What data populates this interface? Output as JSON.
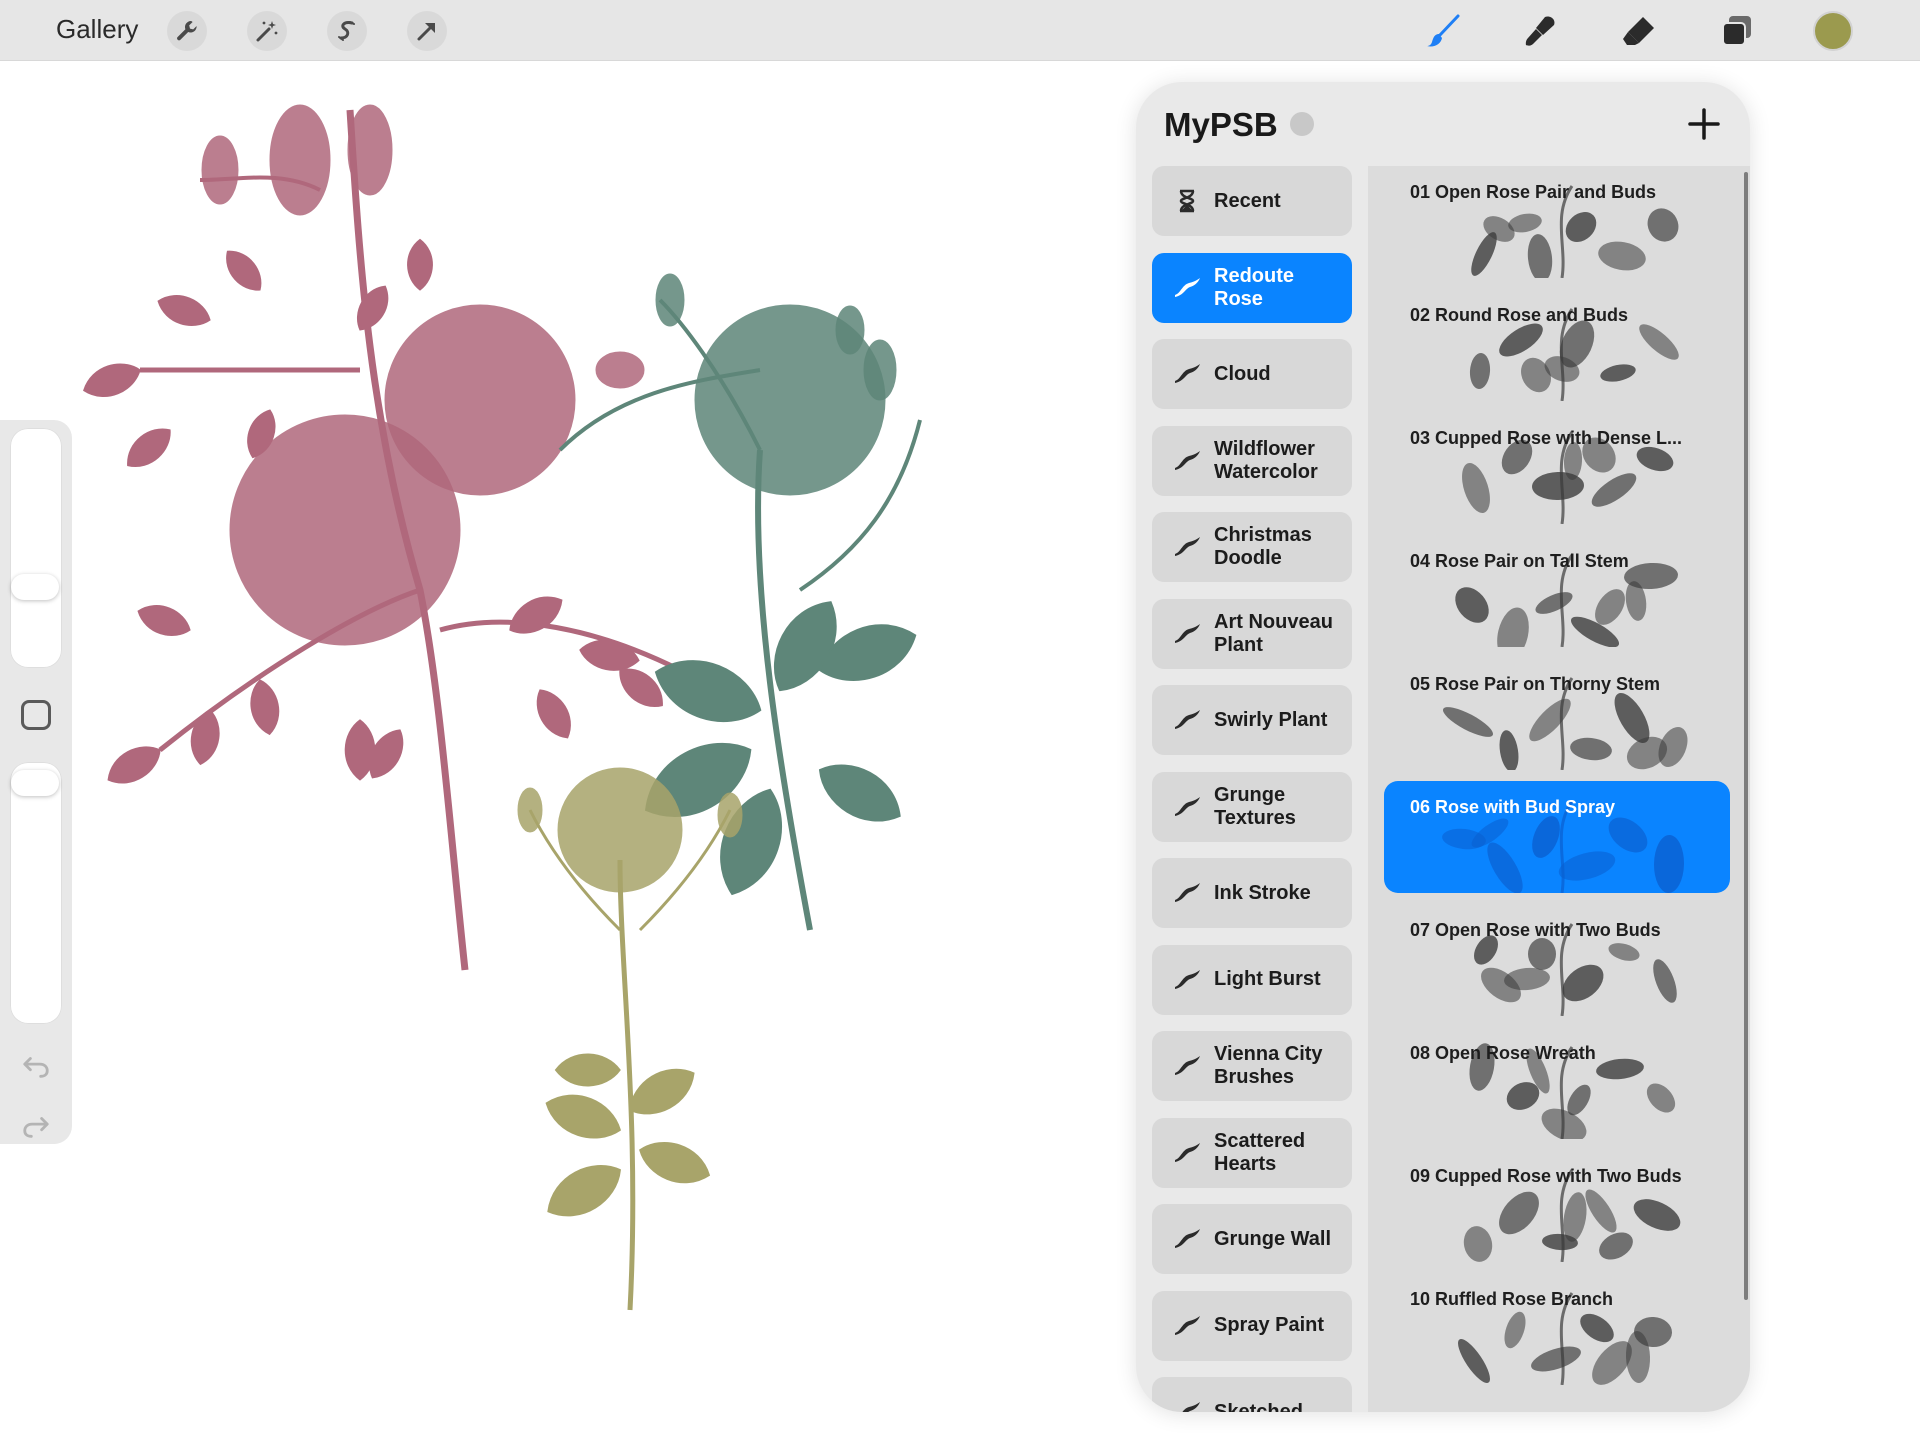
{
  "toolbar": {
    "gallery_label": "Gallery",
    "left_tools": [
      {
        "icon": "wrench-icon"
      },
      {
        "icon": "magic-wand-icon"
      },
      {
        "icon": "selection-icon"
      },
      {
        "icon": "transform-arrow-icon"
      }
    ],
    "right_tools": [
      {
        "icon": "brush-icon",
        "color": "#1f7ff5"
      },
      {
        "icon": "smudge-icon",
        "color": "#2b2b2b"
      },
      {
        "icon": "eraser-icon",
        "color": "#2b2b2b"
      },
      {
        "icon": "layers-icon",
        "color": "#2b2b2b"
      }
    ],
    "current_color": "#9b9a4e"
  },
  "sidebar": {
    "icons": [
      "square-modify-icon",
      "undo-icon",
      "redo-icon"
    ]
  },
  "panel": {
    "title": "MyPSB",
    "add_icon": "plus-icon",
    "sets": [
      {
        "label": "Recent",
        "icon": "hourglass-icon",
        "active": false
      },
      {
        "label": "Redoute Rose",
        "icon": "brush-stroke-icon",
        "active": true
      },
      {
        "label": "Cloud",
        "icon": "brush-stroke-icon",
        "active": false
      },
      {
        "label": "Wildflower Watercolor",
        "icon": "brush-stroke-icon",
        "active": false
      },
      {
        "label": "Christmas Doodle",
        "icon": "brush-stroke-icon",
        "active": false
      },
      {
        "label": "Art Nouveau Plant",
        "icon": "brush-stroke-icon",
        "active": false
      },
      {
        "label": "Swirly Plant",
        "icon": "brush-stroke-icon",
        "active": false
      },
      {
        "label": "Grunge Textures",
        "icon": "brush-stroke-icon",
        "active": false
      },
      {
        "label": "Ink Stroke",
        "icon": "brush-stroke-icon",
        "active": false
      },
      {
        "label": "Light Burst",
        "icon": "brush-stroke-icon",
        "active": false
      },
      {
        "label": "Vienna City Brushes",
        "icon": "brush-stroke-icon",
        "active": false
      },
      {
        "label": "Scattered Hearts",
        "icon": "brush-stroke-icon",
        "active": false
      },
      {
        "label": "Grunge Wall",
        "icon": "brush-stroke-icon",
        "active": false
      },
      {
        "label": "Spray Paint",
        "icon": "brush-stroke-icon",
        "active": false
      },
      {
        "label": "Sketched",
        "icon": "brush-stroke-icon",
        "active": false
      }
    ],
    "brushes": [
      {
        "label": "01 Open Rose Pair and Buds",
        "active": false
      },
      {
        "label": "02 Round Rose and Buds",
        "active": false
      },
      {
        "label": "03 Cupped Rose with Dense L...",
        "active": false
      },
      {
        "label": "04 Rose Pair on Tall Stem",
        "active": false
      },
      {
        "label": "05 Rose Pair on Thorny Stem",
        "active": false
      },
      {
        "label": "06 Rose with Bud Spray",
        "active": true
      },
      {
        "label": "07 Open Rose with Two Buds",
        "active": false
      },
      {
        "label": "08 Open Rose Wreath",
        "active": false
      },
      {
        "label": "09 Cupped Rose with Two Buds",
        "active": false
      },
      {
        "label": "10 Ruffled Rose Branch",
        "active": false
      }
    ],
    "accent_color": "#0a84ff"
  },
  "canvas": {
    "flower_colors": {
      "pink": "#b0687c",
      "green": "#5e8679",
      "olive": "#a8a46a"
    }
  }
}
